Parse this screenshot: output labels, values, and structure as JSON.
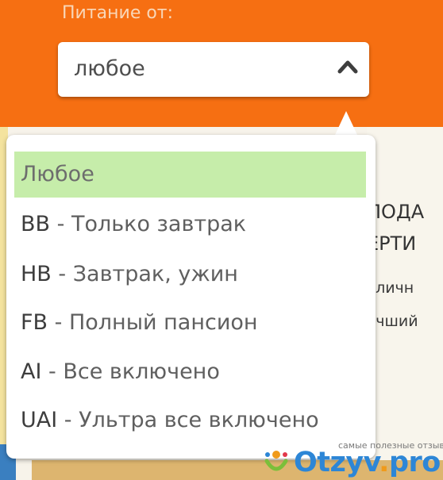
{
  "filter": {
    "label": "Питание от:",
    "selected_value": "любое"
  },
  "options": [
    {
      "code": "",
      "label": "Любое",
      "selected": true
    },
    {
      "code": "BB",
      "label": " - Только завтрак",
      "selected": false
    },
    {
      "code": "HB",
      "label": " - Завтрак, ужин",
      "selected": false
    },
    {
      "code": "FB",
      "label": " - Полный пансион",
      "selected": false
    },
    {
      "code": "AI",
      "label": " - Все включено",
      "selected": false
    },
    {
      "code": "UAI",
      "label": " - Ультра все включено",
      "selected": false
    }
  ],
  "background": {
    "headline_1": "ПОДА",
    "headline_2": "ЕРТИ",
    "text_1": "тличн",
    "text_2": "учший"
  },
  "watermark": {
    "tagline": "самые полезные отзывы",
    "logo_main": "Otzyv",
    "logo_dot": ".",
    "logo_tld": "pro"
  },
  "colors": {
    "accent_orange": "#f66f12",
    "selected_option": "#c6edaa",
    "logo_blue": "#2d86d6"
  },
  "icons": [
    "chevron-up-icon",
    "otzyv-logo-icon"
  ]
}
